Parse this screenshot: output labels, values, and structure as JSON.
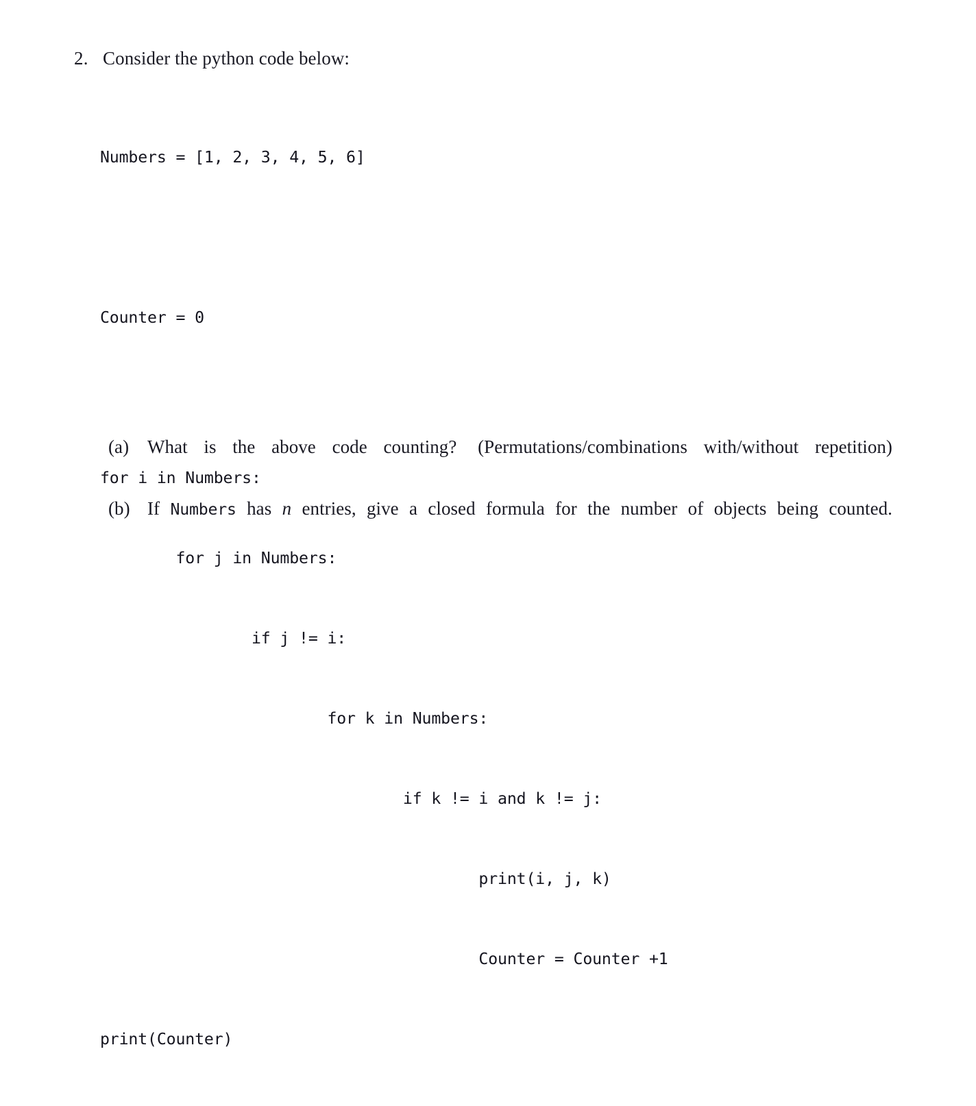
{
  "document": {
    "background_color": "#ffffff",
    "text_color": "#1a1a24"
  },
  "problem": {
    "number": "2.",
    "title": "Consider the python code below:"
  },
  "code": {
    "language": "python",
    "indent_spaces_per_level": 8,
    "lines": [
      "Numbers = [1, 2, 3, 4, 5, 6]",
      "",
      "Counter = 0",
      "",
      "for i in Numbers:",
      "        for j in Numbers:",
      "                if j != i:",
      "                        for k in Numbers:",
      "                                if k != i and k != j:",
      "                                        print(i, j, k)",
      "                                        Counter = Counter +1",
      "print(Counter)"
    ]
  },
  "subitems": [
    {
      "label": "(a)",
      "text_part_1": "What is the above code counting?",
      "text_part_2": "(Permutations/combinations with/without repetition)"
    },
    {
      "label": "(b)",
      "text_part_1": "If",
      "mono_term": "Numbers",
      "text_part_2": "has",
      "math_symbol": "n",
      "text_part_3": "entries, give a closed formula for the number of objects being counted."
    }
  ]
}
